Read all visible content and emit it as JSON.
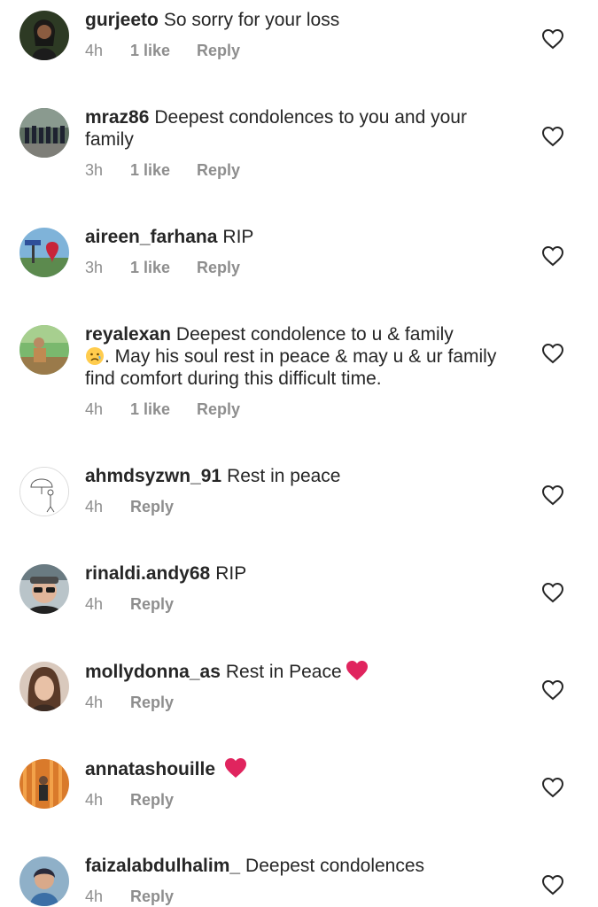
{
  "comments": [
    {
      "username": "gurjeeto",
      "text": "So sorry for your loss",
      "time": "4h",
      "likes": "1 like",
      "reply": "Reply"
    },
    {
      "username": "mraz86",
      "text": "Deepest condolences to you and your family",
      "time": "3h",
      "likes": "1 like",
      "reply": "Reply"
    },
    {
      "username": "aireen_farhana",
      "text": "RIP",
      "time": "3h",
      "likes": "1 like",
      "reply": "Reply"
    },
    {
      "username": "reyalexan",
      "text": "Deepest condolence to u & family",
      "text_after_emoji": ". May his soul rest in peace & may u & ur family find comfort during this difficult time.",
      "emoji": "crying-face",
      "time": "4h",
      "likes": "1 like",
      "reply": "Reply"
    },
    {
      "username": "ahmdsyzwn_91",
      "text": "Rest in peace",
      "time": "4h",
      "reply": "Reply"
    },
    {
      "username": "rinaldi.andy68",
      "text": "RIP",
      "time": "4h",
      "reply": "Reply"
    },
    {
      "username": "mollydonna_as",
      "text": "Rest in Peace",
      "emoji": "red-heart",
      "time": "4h",
      "reply": "Reply"
    },
    {
      "username": "annatashouille",
      "text": "",
      "emoji": "red-heart",
      "time": "4h",
      "reply": "Reply"
    },
    {
      "username": "faizalabdulhalim_",
      "text": "Deepest condolences",
      "time": "4h",
      "reply": "Reply"
    }
  ],
  "icons": {
    "like": "heart-outline-icon",
    "emoji_heart": "red-heart",
    "emoji_cry": "crying-face"
  },
  "colors": {
    "text": "#262626",
    "secondary": "#8e8e8e",
    "heart_emoji": "#e0245e"
  }
}
